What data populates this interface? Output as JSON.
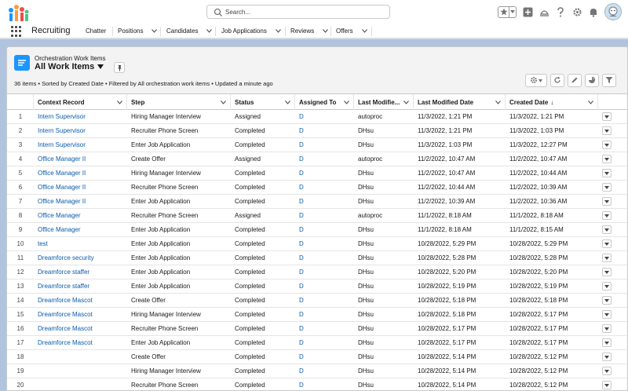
{
  "header": {
    "search_placeholder": "Search..."
  },
  "nav": {
    "app_name": "Recruiting",
    "tabs": [
      "Chatter",
      "Positions",
      "Candidates",
      "Job Applications",
      "Reviews",
      "Offers"
    ]
  },
  "list_view": {
    "object_label": "Orchestration Work Items",
    "view_name": "All Work Items",
    "status_line": "36 items • Sorted by Created Date • Filtered by All orchestration work items • Updated a minute ago"
  },
  "table": {
    "columns": [
      "",
      "Context Record",
      "Step",
      "Status",
      "Assigned To",
      "Last Modifie...",
      "Last Modified Date",
      "Created Date"
    ],
    "sort_indicator": "↓",
    "rows": [
      {
        "n": "1",
        "context": "Intern Supervisor",
        "step": "Hiring Manager Interview",
        "status": "Assigned",
        "assigned": "D",
        "lmby": "autoproc",
        "lmdate": "11/3/2022, 1:21 PM",
        "created": "11/3/2022, 1:21 PM"
      },
      {
        "n": "2",
        "context": "Intern Supervisor",
        "step": "Recruiter Phone Screen",
        "status": "Completed",
        "assigned": "D",
        "lmby": "DHsu",
        "lmdate": "11/3/2022, 1:21 PM",
        "created": "11/3/2022, 1:03 PM"
      },
      {
        "n": "3",
        "context": "Intern Supervisor",
        "step": "Enter Job Application",
        "status": "Completed",
        "assigned": "D",
        "lmby": "DHsu",
        "lmdate": "11/3/2022, 1:03 PM",
        "created": "11/3/2022, 12:27 PM"
      },
      {
        "n": "4",
        "context": "Office Manager II",
        "step": "Create Offer",
        "status": "Assigned",
        "assigned": "D",
        "lmby": "autoproc",
        "lmdate": "11/2/2022, 10:47 AM",
        "created": "11/2/2022, 10:47 AM"
      },
      {
        "n": "5",
        "context": "Office Manager II",
        "step": "Hiring Manager Interview",
        "status": "Completed",
        "assigned": "D",
        "lmby": "DHsu",
        "lmdate": "11/2/2022, 10:47 AM",
        "created": "11/2/2022, 10:44 AM"
      },
      {
        "n": "6",
        "context": "Office Manager II",
        "step": "Recruiter Phone Screen",
        "status": "Completed",
        "assigned": "D",
        "lmby": "DHsu",
        "lmdate": "11/2/2022, 10:44 AM",
        "created": "11/2/2022, 10:39 AM"
      },
      {
        "n": "7",
        "context": "Office Manager II",
        "step": "Enter Job Application",
        "status": "Completed",
        "assigned": "D",
        "lmby": "DHsu",
        "lmdate": "11/2/2022, 10:39 AM",
        "created": "11/2/2022, 10:36 AM"
      },
      {
        "n": "8",
        "context": "Office Manager",
        "step": "Recruiter Phone Screen",
        "status": "Assigned",
        "assigned": "D",
        "lmby": "autoproc",
        "lmdate": "11/1/2022, 8:18 AM",
        "created": "11/1/2022, 8:18 AM"
      },
      {
        "n": "9",
        "context": "Office Manager",
        "step": "Enter Job Application",
        "status": "Completed",
        "assigned": "D",
        "lmby": "DHsu",
        "lmdate": "11/1/2022, 8:18 AM",
        "created": "11/1/2022, 8:15 AM"
      },
      {
        "n": "10",
        "context": "test",
        "step": "Enter Job Application",
        "status": "Completed",
        "assigned": "D",
        "lmby": "DHsu",
        "lmdate": "10/28/2022, 5:29 PM",
        "created": "10/28/2022, 5:29 PM"
      },
      {
        "n": "11",
        "context": "Dreamforce security",
        "step": "Enter Job Application",
        "status": "Completed",
        "assigned": "D",
        "lmby": "DHsu",
        "lmdate": "10/28/2022, 5:28 PM",
        "created": "10/28/2022, 5:28 PM"
      },
      {
        "n": "12",
        "context": "Dreamforce staffer",
        "step": "Enter Job Application",
        "status": "Completed",
        "assigned": "D",
        "lmby": "DHsu",
        "lmdate": "10/28/2022, 5:20 PM",
        "created": "10/28/2022, 5:20 PM"
      },
      {
        "n": "13",
        "context": "Dreamforce staffer",
        "step": "Enter Job Application",
        "status": "Completed",
        "assigned": "D",
        "lmby": "DHsu",
        "lmdate": "10/28/2022, 5:19 PM",
        "created": "10/28/2022, 5:19 PM"
      },
      {
        "n": "14",
        "context": "Dreamforce Mascot",
        "step": "Create Offer",
        "status": "Completed",
        "assigned": "D",
        "lmby": "DHsu",
        "lmdate": "10/28/2022, 5:18 PM",
        "created": "10/28/2022, 5:18 PM"
      },
      {
        "n": "15",
        "context": "Dreamforce Mascot",
        "step": "Hiring Manager Interview",
        "status": "Completed",
        "assigned": "D",
        "lmby": "DHsu",
        "lmdate": "10/28/2022, 5:18 PM",
        "created": "10/28/2022, 5:17 PM"
      },
      {
        "n": "16",
        "context": "Dreamforce Mascot",
        "step": "Recruiter Phone Screen",
        "status": "Completed",
        "assigned": "D",
        "lmby": "DHsu",
        "lmdate": "10/28/2022, 5:17 PM",
        "created": "10/28/2022, 5:17 PM"
      },
      {
        "n": "17",
        "context": "Dreamforce Mascot",
        "step": "Enter Job Application",
        "status": "Completed",
        "assigned": "D",
        "lmby": "DHsu",
        "lmdate": "10/28/2022, 5:17 PM",
        "created": "10/28/2022, 5:17 PM"
      },
      {
        "n": "18",
        "context": "",
        "step": "Create Offer",
        "status": "Completed",
        "assigned": "D",
        "lmby": "DHsu",
        "lmdate": "10/28/2022, 5:14 PM",
        "created": "10/28/2022, 5:12 PM"
      },
      {
        "n": "19",
        "context": "",
        "step": "Hiring Manager Interview",
        "status": "Completed",
        "assigned": "D",
        "lmby": "DHsu",
        "lmdate": "10/28/2022, 5:14 PM",
        "created": "10/28/2022, 5:12 PM"
      },
      {
        "n": "20",
        "context": "",
        "step": "Recruiter Phone Screen",
        "status": "Completed",
        "assigned": "D",
        "lmby": "DHsu",
        "lmdate": "10/28/2022, 5:14 PM",
        "created": "10/28/2022, 5:12 PM"
      }
    ]
  },
  "colors": {
    "link": "#0b5cab",
    "brand": "#1b96ff",
    "background": "#b0c4df"
  },
  "icons": [
    "app-logo-icon",
    "search-icon",
    "favorites-star-icon",
    "add-icon",
    "guidance-icon",
    "help-icon",
    "setup-gear-icon",
    "notification-bell-icon",
    "avatar",
    "waffle-icon",
    "list-view-icon",
    "pin-icon",
    "list-settings-icon",
    "refresh-icon",
    "edit-icon",
    "chart-icon",
    "filter-icon"
  ]
}
